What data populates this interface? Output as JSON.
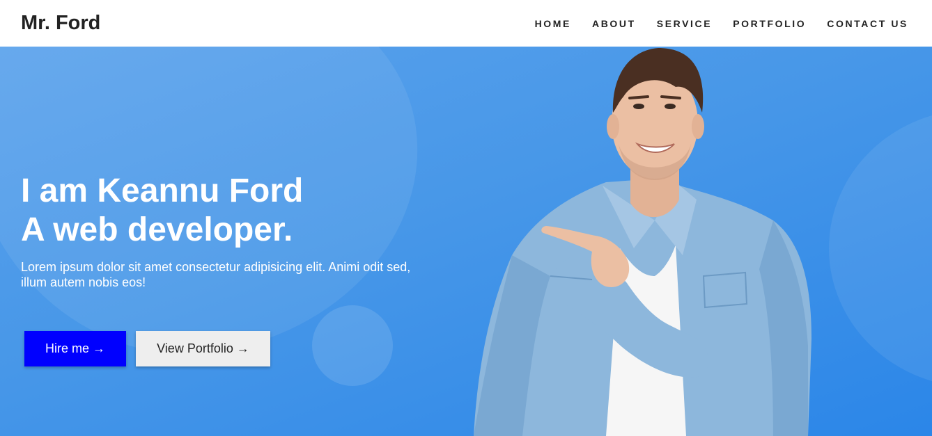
{
  "brand": {
    "logo": "Mr. Ford"
  },
  "nav": {
    "items": [
      {
        "label": "HOME"
      },
      {
        "label": "ABOUT"
      },
      {
        "label": "SERVICE"
      },
      {
        "label": "PORTFOLIO"
      },
      {
        "label": "CONTACT US"
      }
    ]
  },
  "hero": {
    "headline_line1": "I am Keannu Ford",
    "headline_line2": "A web developer.",
    "description": "Lorem ipsum dolor sit amet consectetur adipisicing elit. Animi odit sed, illum autem nobis eos!",
    "hire_button": "Hire me →",
    "portfolio_button": "View Portfolio →",
    "image_subject": "smiling man pointing"
  },
  "colors": {
    "hero_background": "#4797e8",
    "hire_button": "#0000ff",
    "portfolio_button": "#eeeeee",
    "nav_text": "#222222"
  }
}
